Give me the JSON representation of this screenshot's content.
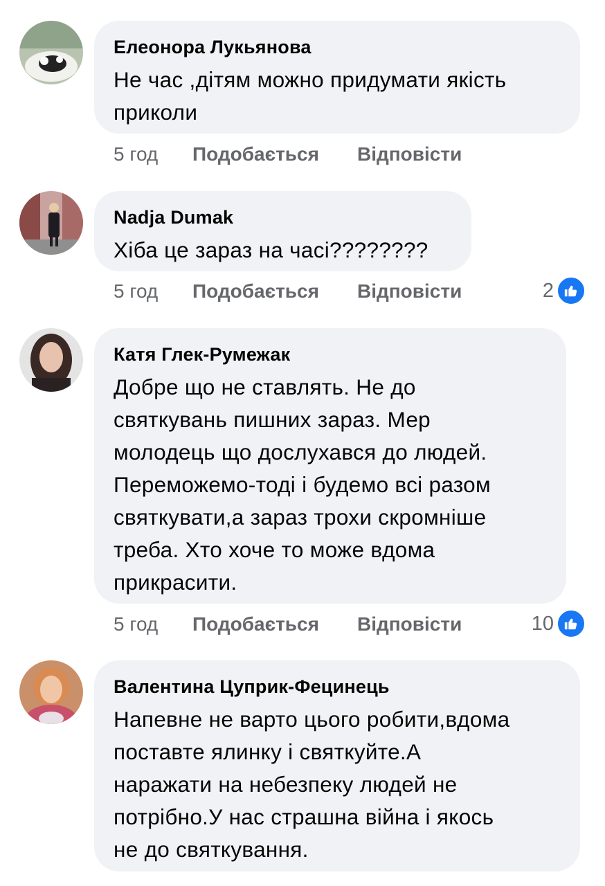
{
  "actions": {
    "like_label": "Подобається",
    "reply_label": "Відповісти"
  },
  "colors": {
    "bubble": "#f0f2f5",
    "meta_text": "#65676b",
    "like_blue": "#1877f2"
  },
  "comments": [
    {
      "author": "Елеонора Лукьянова",
      "lines": [
        "Не час ,дітям можно придумати якість",
        "приколи"
      ],
      "time": "5 год",
      "reactions": null
    },
    {
      "author": "Nadja Dumak",
      "lines": [
        "Хіба це зараз на часі????????"
      ],
      "time": "5 год",
      "reactions": {
        "count": "2",
        "icon": "thumbs-up-icon"
      }
    },
    {
      "author": "Катя Глек-Румежак",
      "lines": [
        "Добре що не ставлять. Не до",
        "святкувань пишних зараз. Мер",
        "молодець що дослухався до людей.",
        "Переможемо-тоді і будемо всі разом",
        "святкувати,а зараз трохи скромніше",
        "треба. Хто хоче то може вдома",
        "прикрасити."
      ],
      "time": "5 год",
      "reactions": {
        "count": "10",
        "icon": "thumbs-up-icon"
      }
    },
    {
      "author": "Валентина Цуприк-Фецинець",
      "lines": [
        "Напевне не варто цього робити,вдома",
        "поставте ялинку і святкуйте.А",
        "наражати на небезпеку людей не",
        "потрібно.У нас страшна війна і якось",
        "не до святкування."
      ],
      "time": null,
      "reactions": null
    }
  ]
}
